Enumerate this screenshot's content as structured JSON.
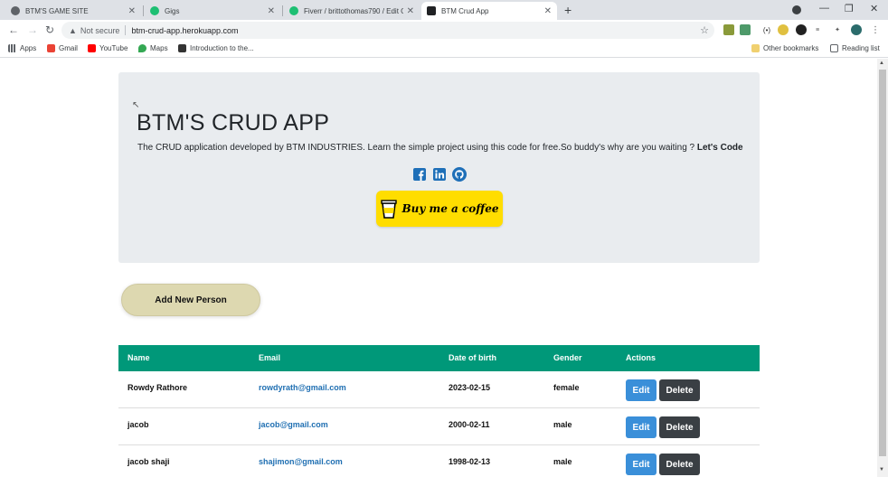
{
  "browser": {
    "tabs": [
      {
        "title": "BTM'S GAME SITE",
        "favicon_color": "#5f6368"
      },
      {
        "title": "Gigs",
        "favicon_color": "#1dbf73"
      },
      {
        "title": "Fiverr / brittothomas790 / Edit Gi",
        "favicon_color": "#1dbf73"
      },
      {
        "title": "BTM Crud App",
        "favicon_color": "#202124",
        "active": true
      }
    ],
    "new_tab": "+",
    "security_label": "Not secure",
    "url": "btm-crud-app.herokuapp.com",
    "bookmarks": [
      {
        "label": "Apps",
        "icon": "apps-grid-icon"
      },
      {
        "label": "Gmail",
        "icon": "gmail-icon"
      },
      {
        "label": "YouTube",
        "icon": "youtube-icon"
      },
      {
        "label": "Maps",
        "icon": "maps-icon"
      },
      {
        "label": "Introduction to the...",
        "icon": "bookmark-page-icon"
      }
    ],
    "other_bookmarks": "Other bookmarks",
    "reading_list": "Reading list"
  },
  "jumbotron": {
    "title": "BTM'S CRUD APP",
    "description": "The CRUD application developed by BTM INDUSTRIES. Learn the simple project using this code for free.So buddy's why are you waiting ?",
    "description_bold": "Let's Code",
    "coffee_label": "Buy me a coffee"
  },
  "add_button_label": "Add New Person",
  "table": {
    "headers": [
      "Name",
      "Email",
      "Date of birth",
      "Gender",
      "Actions"
    ],
    "rows": [
      {
        "name": "Rowdy Rathore",
        "email": "rowdyrath@gmail.com",
        "dob": "2023-02-15",
        "gender": "female"
      },
      {
        "name": "jacob",
        "email": "jacob@gmail.com",
        "dob": "2000-02-11",
        "gender": "male"
      },
      {
        "name": "jacob shaji",
        "email": "shajimon@gmail.com",
        "dob": "1998-02-13",
        "gender": "male"
      }
    ],
    "edit_label": "Edit",
    "delete_label": "Delete"
  },
  "colors": {
    "table_header": "#009879",
    "coffee_button": "#ffdd00",
    "edit_button": "#3a8fd9",
    "delete_button": "#3a3f44",
    "add_button": "#ddd8b0"
  }
}
